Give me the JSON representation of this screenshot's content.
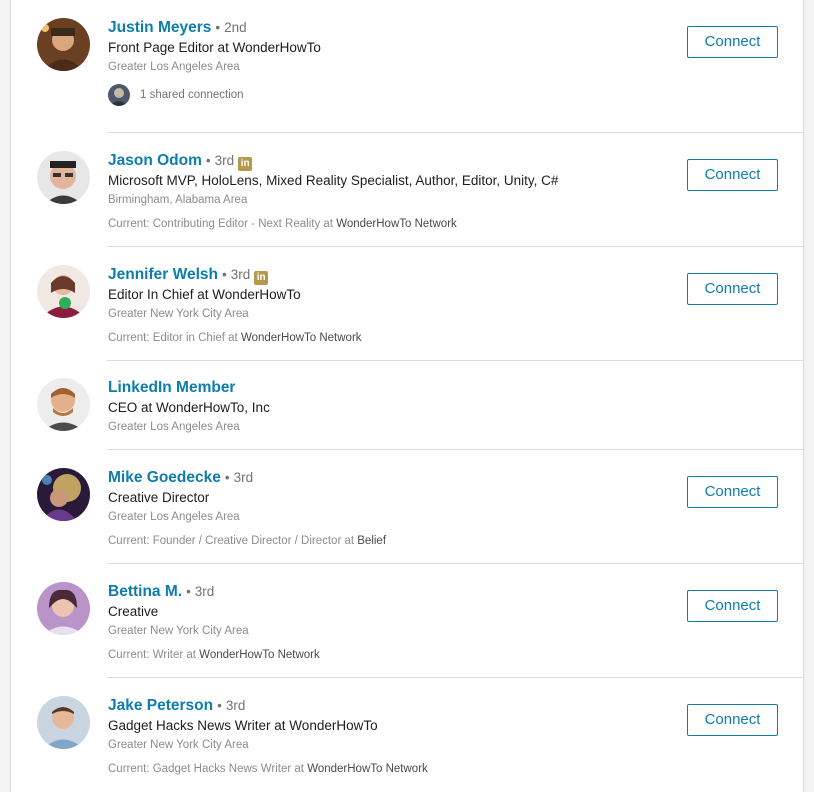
{
  "results": [
    {
      "name": "Justin Meyers",
      "degree": "2nd",
      "linkedin_badge": false,
      "headline": "Front Page Editor at WonderHowTo",
      "location": "Greater Los Angeles Area",
      "shared": "1 shared connection",
      "connect_label": "Connect"
    },
    {
      "name": "Jason Odom",
      "degree": "3rd",
      "linkedin_badge": true,
      "headline": "Microsoft MVP, HoloLens, Mixed Reality Specialist, Author, Editor, Unity, C#",
      "location": "Birmingham, Alabama Area",
      "current_prefix": "Current: Contributing Editor - Next Reality at ",
      "current_org": "WonderHowTo Network",
      "connect_label": "Connect"
    },
    {
      "name": "Jennifer Welsh",
      "degree": "3rd",
      "linkedin_badge": true,
      "headline": "Editor In Chief at WonderHowTo",
      "location": "Greater New York City Area",
      "current_prefix": "Current: Editor in Chief at ",
      "current_org": "WonderHowTo Network",
      "connect_label": "Connect"
    },
    {
      "name": "LinkedIn Member",
      "headline": "CEO at WonderHowTo, Inc",
      "location": "Greater Los Angeles Area"
    },
    {
      "name": "Mike Goedecke",
      "degree": "3rd",
      "linkedin_badge": false,
      "headline": "Creative Director",
      "location": "Greater Los Angeles Area",
      "current_prefix": "Current: Founder / Creative Director / Director at ",
      "current_org": "Belief",
      "connect_label": "Connect"
    },
    {
      "name": "Bettina M.",
      "degree": "3rd",
      "linkedin_badge": false,
      "headline": "Creative",
      "location": "Greater New York City Area",
      "current_prefix": "Current: Writer at ",
      "current_org": "WonderHowTo Network",
      "connect_label": "Connect"
    },
    {
      "name": "Jake Peterson",
      "degree": "3rd",
      "linkedin_badge": false,
      "headline": "Gadget Hacks News Writer at WonderHowTo",
      "location": "Greater New York City Area",
      "current_prefix": "Current: Gadget Hacks News Writer at ",
      "current_org": "WonderHowTo Network",
      "connect_label": "Connect"
    }
  ],
  "badge_text": "in",
  "colors": {
    "link": "#0e7dac",
    "badge": "#b59a4e"
  }
}
